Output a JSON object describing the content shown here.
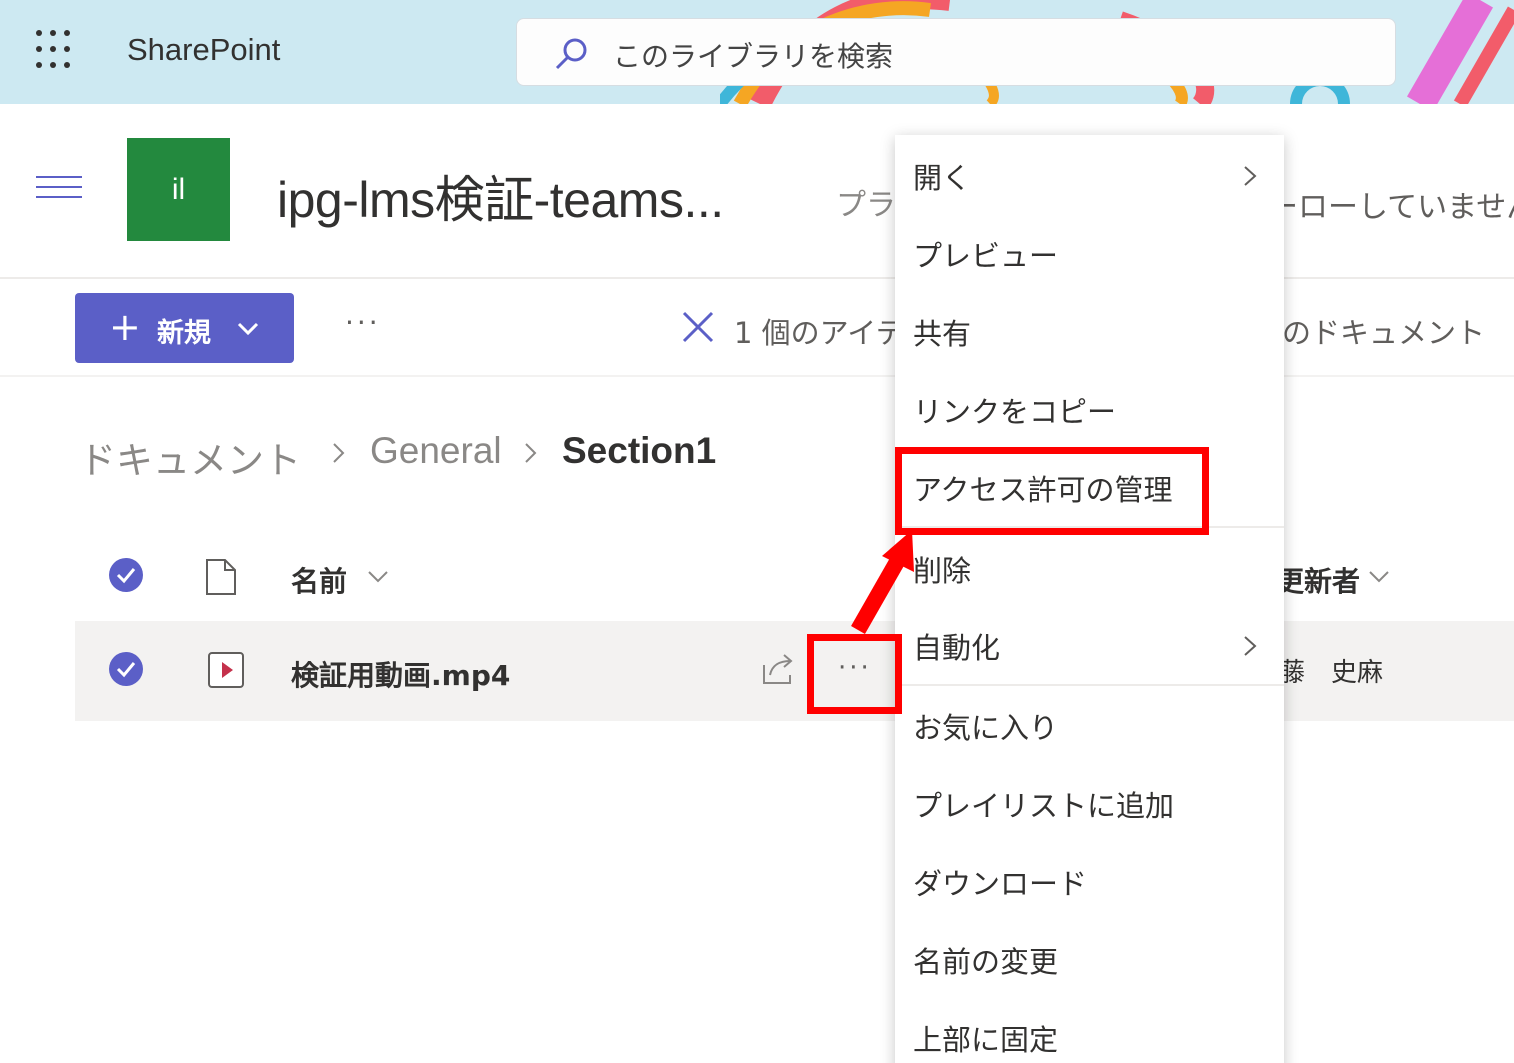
{
  "topbar": {
    "app_name": "SharePoint",
    "search_placeholder": "このライブラリを検索"
  },
  "site": {
    "logo_text": "il",
    "title": "ipg-lms検証-teams...",
    "sub_left": "プラ",
    "sub_right": "ーローしていません"
  },
  "commandbar": {
    "new_label": "新規",
    "more": "···",
    "selection_text": "1 個のアイテ",
    "right_text": "のドキュメント"
  },
  "breadcrumb": {
    "items": [
      "ドキュメント",
      "General",
      "Section1"
    ]
  },
  "list": {
    "columns": {
      "name": "名前",
      "modified_by": "更新者"
    },
    "rows": [
      {
        "name": "検証用動画.mp4",
        "modified_by": "藤　史麻",
        "more": "···"
      }
    ]
  },
  "context_menu": {
    "items": [
      {
        "label": "開く",
        "has_submenu": true
      },
      {
        "label": "プレビュー"
      },
      {
        "label": "共有"
      },
      {
        "label": "リンクをコピー"
      },
      {
        "label": "アクセス許可の管理",
        "highlighted": true
      },
      {
        "label": "削除"
      },
      {
        "label": "自動化",
        "has_submenu": true
      },
      {
        "label": "お気に入り"
      },
      {
        "label": "プレイリストに追加"
      },
      {
        "label": "ダウンロード"
      },
      {
        "label": "名前の変更"
      },
      {
        "label": "上部に固定"
      }
    ]
  },
  "colors": {
    "accent": "#5b5fc7",
    "site_logo": "#23893e",
    "highlight": "#ff0000",
    "topbar": "#cde9f2"
  }
}
